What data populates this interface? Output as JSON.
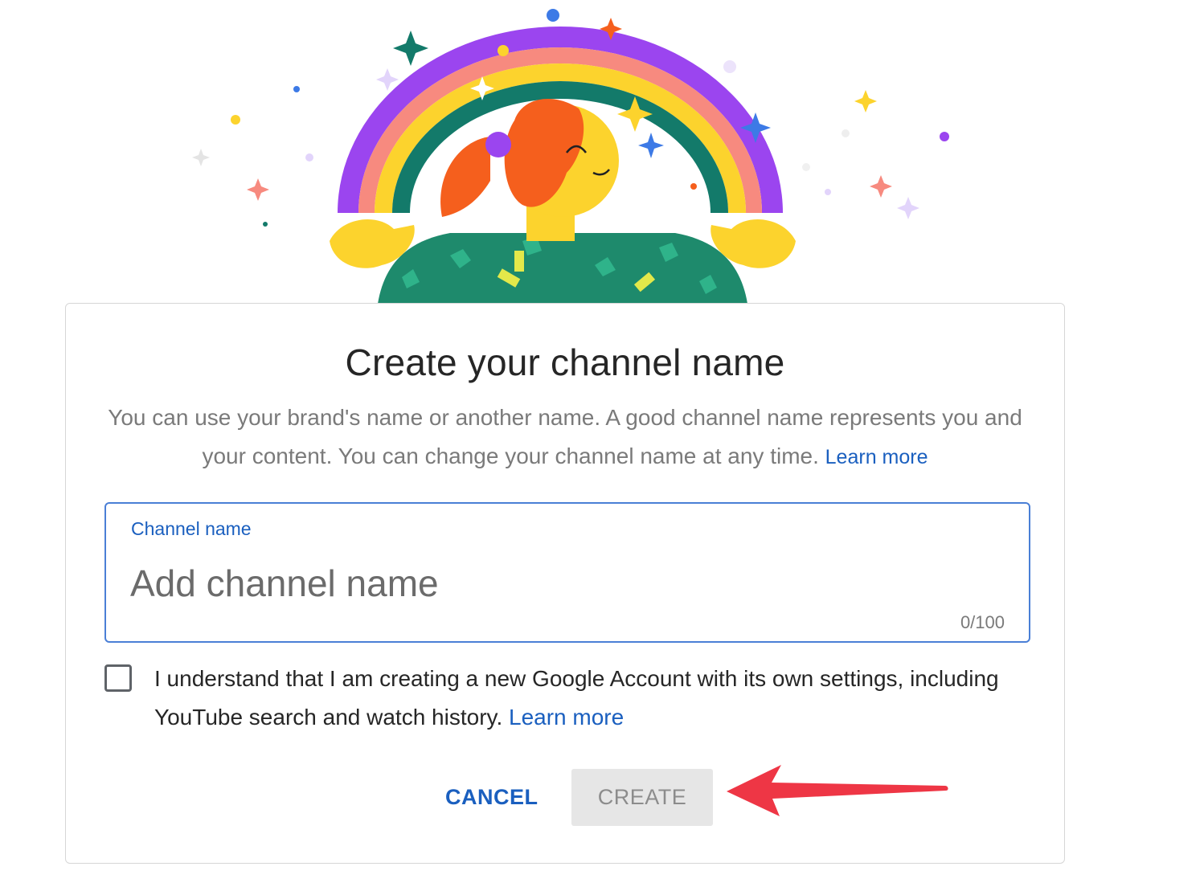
{
  "dialog": {
    "title": "Create your channel name",
    "description": "You can use your brand's name or another name. A good channel name represents you and your content. You can change your channel name at any time.",
    "description_link": "Learn more"
  },
  "channel_field": {
    "label": "Channel name",
    "placeholder": "Add channel name",
    "value": "",
    "counter": "0/100"
  },
  "consent": {
    "checked": false,
    "text": "I understand that I am creating a new Google Account with its own settings, including YouTube search and watch history.",
    "link": "Learn more"
  },
  "actions": {
    "cancel_label": "CANCEL",
    "create_label": "CREATE",
    "create_enabled": false
  },
  "colors": {
    "accent": "#1a5fbf",
    "field_border": "#4a7fd6",
    "disabled_bg": "#e6e6e6",
    "annotation_arrow": "#ee3645"
  },
  "icons": {
    "illustration": "rainbow-celebration-illustration",
    "annotation": "red-arrow-annotation"
  }
}
